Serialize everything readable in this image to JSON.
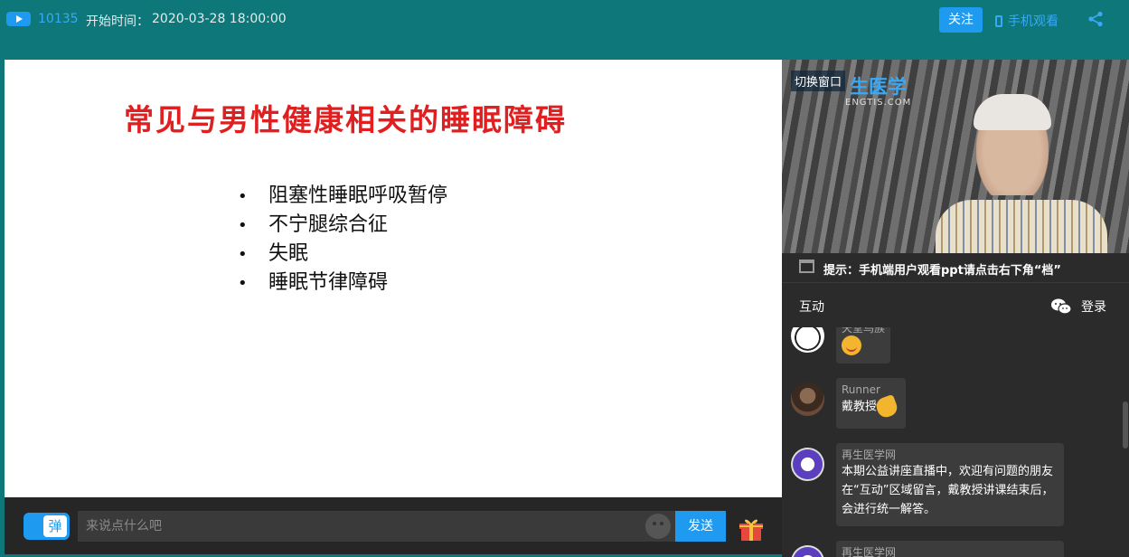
{
  "header": {
    "viewer_count": "10135",
    "start_label": "开始时间：",
    "start_time": "2020-03-28 18:00:00",
    "follow_label": "关注",
    "mobile_label": "手机观看"
  },
  "slide": {
    "title": "常见与男性健康相关的睡眠障碍",
    "bullets": [
      "阻塞性睡眠呼吸暂停",
      "不宁腿综合征",
      "失眠",
      "睡眠节律障碍"
    ],
    "bullet_char": "•"
  },
  "input_bar": {
    "danmu_label": "弹",
    "placeholder": "来说点什么吧",
    "send_label": "发送"
  },
  "video": {
    "switch_label": "切换窗口",
    "logo_text": "生医学",
    "logo_sub": "ENGTIS.COM"
  },
  "tip": {
    "text": "提示：手机端用户观看ppt请点击右下角“档”"
  },
  "panel_tabs": {
    "interact_label": "互动",
    "login_label": "登录"
  },
  "chat": {
    "messages": [
      {
        "user": "天堂鸟族",
        "text": ""
      },
      {
        "user": "Runner",
        "text": "戴教授"
      },
      {
        "user": "再生医学网",
        "text": "本期公益讲座直播中，欢迎有问题的朋友在“互动”区域留言，戴教授讲课结束后，会进行统一解答。"
      },
      {
        "user": "再生医学网",
        "text": ""
      }
    ]
  },
  "colors": {
    "background": "#0e7779",
    "accent": "#1e9bf0",
    "slide_title": "#e02020",
    "panel": "#2b2b2b"
  }
}
